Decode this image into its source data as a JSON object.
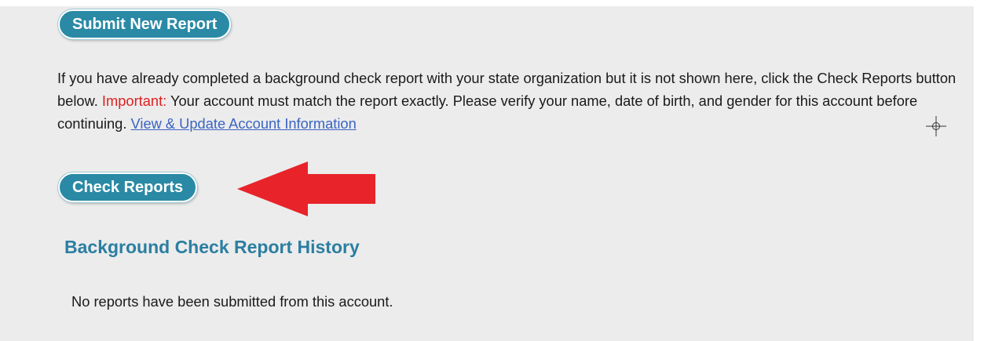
{
  "buttons": {
    "submit_label": "Submit New Report",
    "check_label": "Check Reports"
  },
  "intro": {
    "text_before": "If you have already completed a background check report with your state organization but it is not shown here, click the Check Reports button below. ",
    "important_label": "Important:",
    "text_after": " Your account must match the report exactly. Please verify your name, date of birth, and gender for this account before continuing. ",
    "link_label": "View & Update Account Information"
  },
  "history": {
    "title": "Background Check Report History",
    "empty_message": "No reports have been submitted from this account."
  },
  "icons": {
    "arrow": "left-pointing-arrow-icon",
    "cursor": "crosshair-cursor-icon"
  },
  "colors": {
    "button_bg": "#2a8aa5",
    "important": "#e02020",
    "link": "#3b64c4",
    "heading": "#2b7ea1",
    "arrow": "#e8232a",
    "panel_bg": "#ececec"
  }
}
